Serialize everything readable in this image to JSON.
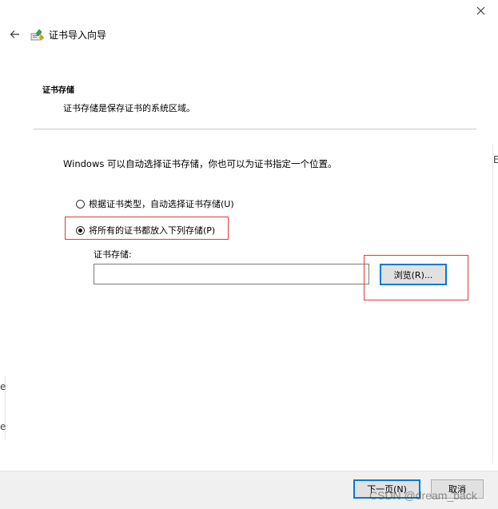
{
  "window": {
    "title": "证书导入向导"
  },
  "section": {
    "title": "证书存储",
    "description": "证书存储是保存证书的系统区域。"
  },
  "intro": "Windows 可以自动选择证书存储，你也可以为证书指定一个位置。",
  "options": [
    {
      "label": "根据证书类型，自动选择证书存储(U)",
      "checked": false
    },
    {
      "label": "将所有的证书都放入下列存储(P)",
      "checked": true
    }
  ],
  "store": {
    "label": "证书存储:",
    "value": "",
    "browse_label": "浏览(R)..."
  },
  "footer": {
    "next_label": "下一页(N)",
    "cancel_label": "取消"
  },
  "watermark": "CSDN @dream_back",
  "background_glyphs": {
    "right": "E",
    "left_1": "e",
    "left_2": "e"
  },
  "colors": {
    "accent": "#0078d7",
    "highlight": "#e03a3a",
    "footer_bg": "#f0f0f0"
  },
  "icons": {
    "close": "close-icon",
    "back": "back-arrow-icon",
    "app": "certificate-icon"
  }
}
